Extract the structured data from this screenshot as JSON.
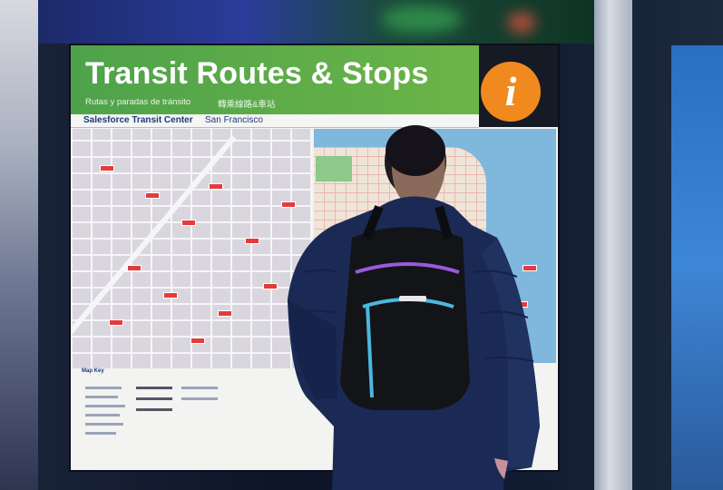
{
  "sign": {
    "title": "Transit Routes & Stops",
    "subtitle_es": "Rutas y paradas de tránsito",
    "subtitle_cn": "轉乘線路&車站",
    "location": "Salesforce Transit Center",
    "city": "San Francisco",
    "key_title": "Map Key",
    "info_glyph": "i"
  },
  "colors": {
    "header_green": "#5aac48",
    "info_orange": "#f08a1e",
    "jacket_navy": "#1b2a55",
    "backpack_accent": "#4ab8e0"
  },
  "icons": [
    "info-icon"
  ]
}
